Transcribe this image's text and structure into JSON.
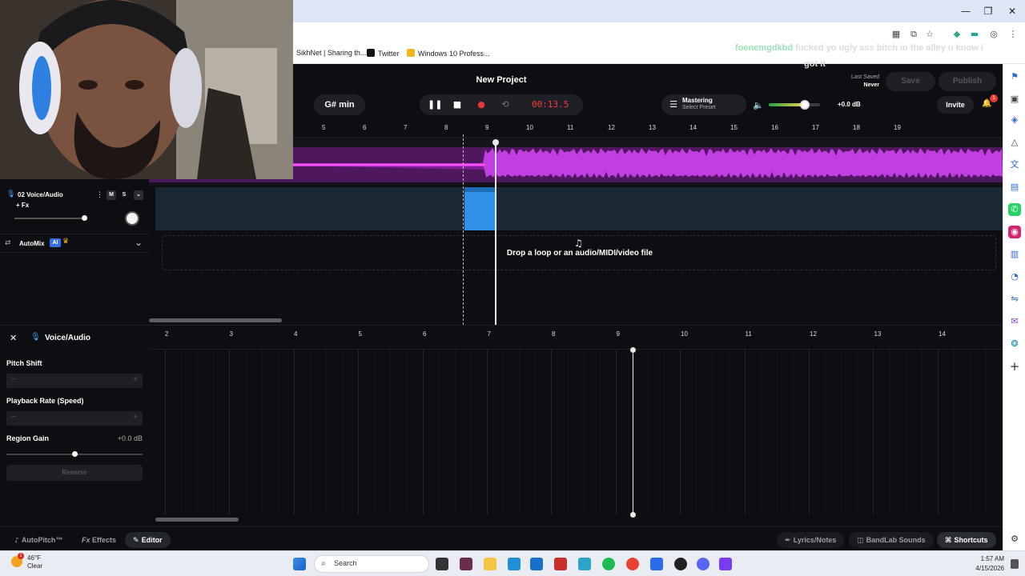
{
  "bookmarks": [
    "SikhNet | Sharing th...",
    "Twitter",
    "Windows 10 Profess..."
  ],
  "chat": {
    "user": "foenemgdkbd",
    "message": "fucked yo ugly ass bitch in the alley u know i",
    "message_cont": "got it"
  },
  "app": {
    "project_title": "New Project",
    "key": "G# min",
    "timecode": "00:13.5",
    "mastering_label": "Mastering",
    "mastering_preset": "Select Preset",
    "volume_db": "+0.0 dB",
    "volume_level": 0.7,
    "last_saved_label": "Last Saved",
    "last_saved_value": "Never",
    "save_label": "Save",
    "publish_label": "Publish",
    "invite_label": "Invite",
    "notification_count": "1"
  },
  "timeline": {
    "ruler_ticks": [
      "5",
      "6",
      "7",
      "8",
      "9",
      "10",
      "11",
      "12",
      "13",
      "14",
      "15",
      "16",
      "17",
      "18",
      "19"
    ]
  },
  "tracks": {
    "track2": {
      "name": "02  Voice/Audio",
      "mute": "M",
      "solo": "S",
      "fx": "+ Fx"
    },
    "automix": {
      "label": "AutoMix",
      "badge": "AI"
    },
    "drop_text": "Drop a loop or an audio/MIDI/video file"
  },
  "editor": {
    "title": "Voice/Audio",
    "pitch_shift_label": "Pitch Shift",
    "playback_rate_label": "Playback Rate (Speed)",
    "region_gain_label": "Region Gain",
    "region_gain_value": "+0.0 dB",
    "reverse_label": "Reverse",
    "minus": "−",
    "plus": "+",
    "ruler_ticks": [
      "2",
      "3",
      "4",
      "5",
      "6",
      "7",
      "8",
      "9",
      "10",
      "11",
      "12",
      "13",
      "14"
    ]
  },
  "bottom": {
    "autopitch": "AutoPitch™",
    "effects": "Effects",
    "effects_prefix": "Fx",
    "editor": "Editor",
    "lyrics": "Lyrics/Notes",
    "sounds": "BandLab Sounds",
    "shortcuts": "Shortcuts"
  },
  "taskbar": {
    "temperature": "46°F",
    "condition": "Clear",
    "search_label": "Search",
    "time": "1:57 AM",
    "date": "4/15/2026"
  },
  "colors": {
    "accent": "#2f90e8",
    "waveform": "#b52bd6",
    "timecode": "#ff3b3b"
  }
}
